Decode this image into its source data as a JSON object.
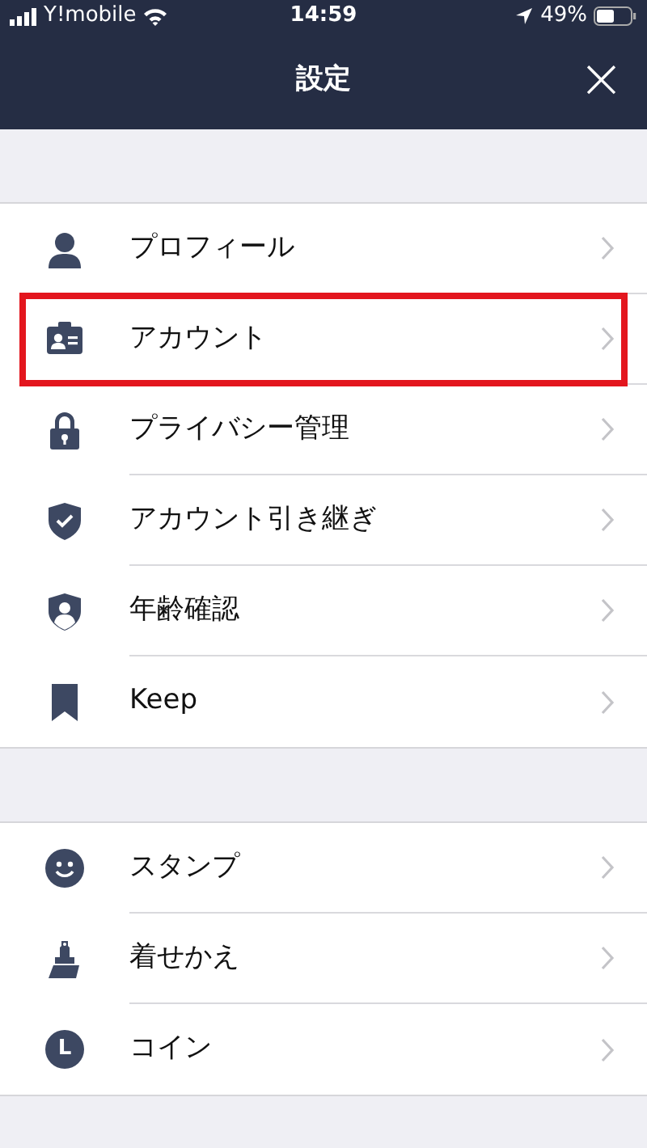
{
  "status_bar": {
    "carrier": "Y!mobile",
    "time": "14:59",
    "battery": "49%"
  },
  "header": {
    "title": "設定",
    "close": "×"
  },
  "sections": [
    {
      "items": [
        {
          "label": "プロフィール",
          "highlighted": false
        },
        {
          "label": "アカウント",
          "highlighted": true
        },
        {
          "label": "プライバシー管理",
          "highlighted": false
        },
        {
          "label": "アカウント引き継ぎ",
          "highlighted": false
        },
        {
          "label": "年齢確認",
          "highlighted": false
        },
        {
          "label": "Keep",
          "highlighted": false
        }
      ]
    },
    {
      "items": [
        {
          "label": "スタンプ",
          "highlighted": false
        },
        {
          "label": "着せかえ",
          "highlighted": false
        },
        {
          "label": "コイン",
          "icon_letter": "L",
          "highlighted": false
        }
      ]
    }
  ]
}
